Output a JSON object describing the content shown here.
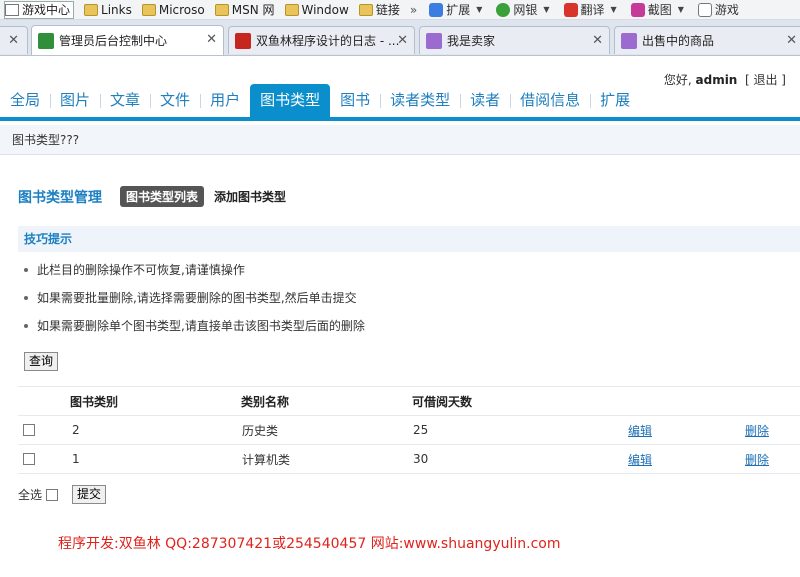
{
  "favbar": {
    "items": [
      "游戏中心",
      "Links",
      "Microso",
      "MSN 网",
      "Window",
      "链接"
    ],
    "more": "»",
    "tools": [
      "扩展",
      "网银",
      "翻译",
      "截图",
      "游戏"
    ]
  },
  "browser_tabs": [
    {
      "label": "",
      "active": false
    },
    {
      "label": "管理员后台控制中心",
      "active": true
    },
    {
      "label": "双鱼林程序设计的日志 - ...",
      "active": false
    },
    {
      "label": "我是卖家",
      "active": false
    },
    {
      "label": "出售中的商品",
      "active": false
    }
  ],
  "header": {
    "greeting_prefix": "您好,",
    "username": "admin",
    "logout": "[ 退出 ]"
  },
  "nav": {
    "items": [
      "全局",
      "图片",
      "文章",
      "文件",
      "用户",
      "图书类型",
      "图书",
      "读者类型",
      "读者",
      "借阅信息",
      "扩展"
    ],
    "active_index": 5
  },
  "breadcrumb": "图书类型???",
  "section": {
    "title": "图书类型管理",
    "active_tab": "图书类型列表",
    "add_link": "添加图书类型"
  },
  "tips": {
    "title": "技巧提示",
    "items": [
      "此栏目的删除操作不可恢复,请谨慎操作",
      "如果需要批量删除,请选择需要删除的图书类型,然后单击提交",
      "如果需要删除单个图书类型,请直接单击该图书类型后面的删除"
    ]
  },
  "query_button": "查询",
  "table": {
    "headers": [
      "图书类别",
      "类别名称",
      "可借阅天数"
    ],
    "rows": [
      {
        "id": "2",
        "name": "历史类",
        "days": "25",
        "edit": "编辑",
        "delete": "删除"
      },
      {
        "id": "1",
        "name": "计算机类",
        "days": "30",
        "edit": "编辑",
        "delete": "删除"
      }
    ]
  },
  "select_all": "全选",
  "submit_button": "提交",
  "footer": "程序开发:双鱼林 QQ:287307421或254540457 网站:www.shuangyulin.com",
  "colors": {
    "accent": "#0a8fcc",
    "link": "#1c7fc2",
    "footer": "#e0231c"
  }
}
